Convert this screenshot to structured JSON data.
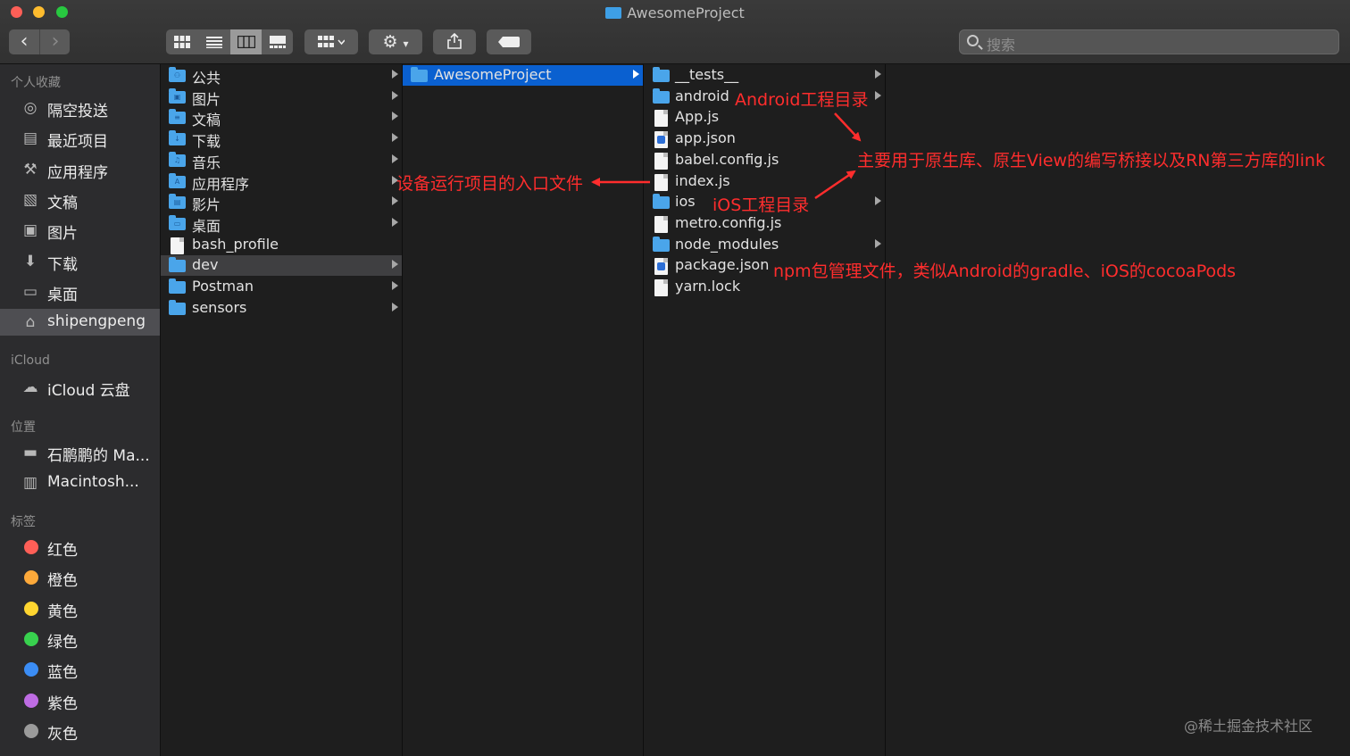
{
  "window": {
    "title": "AwesomeProject"
  },
  "toolbar": {
    "back": "‹",
    "forward": "›",
    "view_icon": "▦▾",
    "action_icon": "⚙▾",
    "share_icon": "⇪",
    "tag_icon": "⬬",
    "search_placeholder": "搜索"
  },
  "sidebar": {
    "favorites_header": "个人收藏",
    "favorites": [
      {
        "label": "隔空投送",
        "icon": "airdrop-icon"
      },
      {
        "label": "最近项目",
        "icon": "recents-icon"
      },
      {
        "label": "应用程序",
        "icon": "applications-icon"
      },
      {
        "label": "文稿",
        "icon": "documents-icon"
      },
      {
        "label": "图片",
        "icon": "pictures-icon"
      },
      {
        "label": "下载",
        "icon": "downloads-icon"
      },
      {
        "label": "桌面",
        "icon": "desktop-icon"
      },
      {
        "label": "shipengpeng",
        "icon": "home-icon"
      }
    ],
    "icloud_header": "iCloud",
    "icloud": [
      {
        "label": "iCloud 云盘",
        "icon": "cloud-icon"
      }
    ],
    "locations_header": "位置",
    "locations": [
      {
        "label": "石鹏鹏的 Ma...",
        "icon": "laptop-icon"
      },
      {
        "label": "Macintosh...",
        "icon": "disk-icon"
      }
    ],
    "tags_header": "标签",
    "tags": [
      {
        "label": "红色",
        "color": "#fe5f57"
      },
      {
        "label": "橙色",
        "color": "#fda93a"
      },
      {
        "label": "黄色",
        "color": "#fed530"
      },
      {
        "label": "绿色",
        "color": "#38d14e"
      },
      {
        "label": "蓝色",
        "color": "#3b8df5"
      },
      {
        "label": "紫色",
        "color": "#be6ce3"
      },
      {
        "label": "灰色",
        "color": "#9b9b9b"
      }
    ]
  },
  "column1": [
    {
      "label": "公共",
      "kind": "folder",
      "glyph": "⚇"
    },
    {
      "label": "图片",
      "kind": "folder",
      "glyph": "▣"
    },
    {
      "label": "文稿",
      "kind": "folder",
      "glyph": "≡"
    },
    {
      "label": "下载",
      "kind": "folder",
      "glyph": "↓"
    },
    {
      "label": "音乐",
      "kind": "folder",
      "glyph": "♫"
    },
    {
      "label": "应用程序",
      "kind": "folder",
      "glyph": "A"
    },
    {
      "label": "影片",
      "kind": "folder",
      "glyph": "▤"
    },
    {
      "label": "桌面",
      "kind": "folder",
      "glyph": "▭"
    },
    {
      "label": "bash_profile",
      "kind": "file"
    },
    {
      "label": "dev",
      "kind": "folder",
      "selected": true
    },
    {
      "label": "Postman",
      "kind": "folder"
    },
    {
      "label": "sensors",
      "kind": "folder"
    }
  ],
  "column2": [
    {
      "label": "AwesomeProject",
      "kind": "folder",
      "selected": true
    }
  ],
  "column3": [
    {
      "label": "__tests__",
      "kind": "folder",
      "chevron": true
    },
    {
      "label": "android",
      "kind": "folder",
      "chevron": true
    },
    {
      "label": "App.js",
      "kind": "file"
    },
    {
      "label": "app.json",
      "kind": "json"
    },
    {
      "label": "babel.config.js",
      "kind": "file"
    },
    {
      "label": "index.js",
      "kind": "file"
    },
    {
      "label": "ios",
      "kind": "folder",
      "chevron": true
    },
    {
      "label": "metro.config.js",
      "kind": "file"
    },
    {
      "label": "node_modules",
      "kind": "folder",
      "chevron": true
    },
    {
      "label": "package.json",
      "kind": "json"
    },
    {
      "label": "yarn.lock",
      "kind": "file"
    }
  ],
  "annotations": {
    "android": "Android工程目录",
    "native": "主要用于原生库、原生View的编写桥接以及RN第三方库的link",
    "entry": "设备运行项目的入口文件",
    "ios": "iOS工程目录",
    "npm": "npm包管理文件，类似Android的gradle、iOS的cocoaPods",
    "color": "#ff2d2d"
  },
  "watermark": "@稀土掘金技术社区"
}
